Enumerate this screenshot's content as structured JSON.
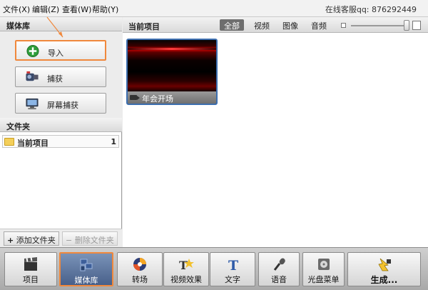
{
  "menu": {
    "items": [
      "文件(X)",
      "编辑(Z)",
      "查看(W)",
      "帮助(Y)"
    ],
    "support": "在线客服qq: 876292449"
  },
  "library": {
    "header": "媒体库",
    "buttons": [
      {
        "label": "导入",
        "icon": "import-icon"
      },
      {
        "label": "捕获",
        "icon": "camcorder-icon"
      },
      {
        "label": "屏幕捕获",
        "icon": "screen-capture-icon"
      }
    ]
  },
  "folders": {
    "header": "文件夹",
    "items": [
      {
        "label": "当前项目",
        "count": "1"
      }
    ],
    "add_label": "添加文件夹",
    "delete_label": "删除文件夹"
  },
  "project": {
    "header": "当前项目",
    "filters": [
      "全部",
      "视频",
      "图像",
      "音频"
    ],
    "active_filter": "全部",
    "media": [
      {
        "name": "年会开场",
        "type": "video"
      }
    ]
  },
  "toolbar": {
    "buttons": [
      {
        "label": "项目",
        "icon": "clapperboard-icon"
      },
      {
        "label": "媒体库",
        "icon": "media-library-icon"
      },
      {
        "label": "转场",
        "icon": "transition-icon"
      },
      {
        "label": "视频效果",
        "icon": "video-effects-icon"
      },
      {
        "label": "文字",
        "icon": "text-icon"
      },
      {
        "label": "语音",
        "icon": "microphone-icon"
      },
      {
        "label": "光盘菜单",
        "icon": "disc-menu-icon"
      },
      {
        "label": "生成...",
        "icon": "generate-icon"
      }
    ],
    "active": "媒体库"
  },
  "colors": {
    "accent_orange": "#f0883c",
    "selection_blue": "#3d6fb0",
    "active_tab_bg": "#6e6e6e",
    "import_green": "#2e9d3a"
  }
}
